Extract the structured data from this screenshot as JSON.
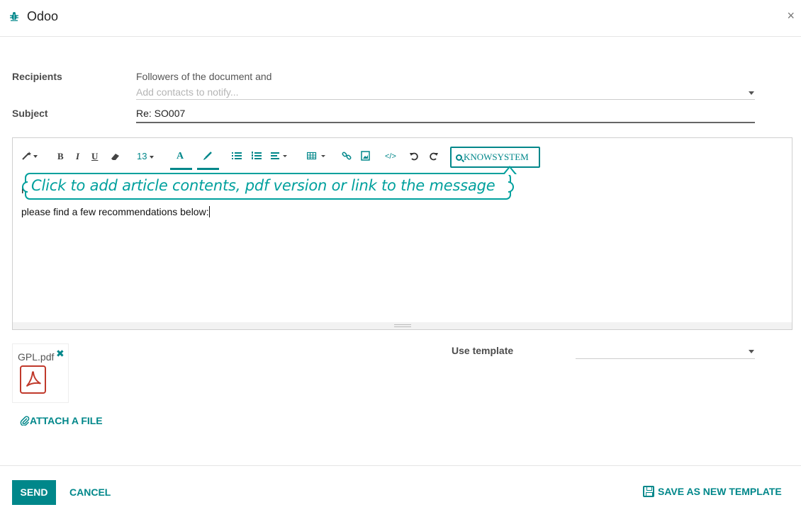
{
  "dialog": {
    "title": "Odoo",
    "close_symbol": "×"
  },
  "recipients": {
    "label": "Recipients",
    "text": "Followers of the document and",
    "placeholder": "Add contacts to notify..."
  },
  "subject": {
    "label": "Subject",
    "value": "Re: SO007"
  },
  "editor": {
    "toolbar": {
      "font_size": "13",
      "bold": "B",
      "italic": "I",
      "underline": "U",
      "text_color": "A",
      "knowsystem": "KNOWSYSTEM"
    },
    "tooltip": "Click to add article contents, pdf version or link to the message",
    "hidden_line": "H",
    "body_line": "please find a few recommendations below:"
  },
  "attachment": {
    "file_name": "GPL.pdf",
    "remove_symbol": "✖"
  },
  "attach_file_label": "ATTACH A FILE",
  "use_template": {
    "label": "Use template",
    "value": ""
  },
  "footer": {
    "send": "SEND",
    "cancel": "CANCEL",
    "save_template": "SAVE AS NEW TEMPLATE"
  },
  "colors": {
    "accent": "#00878a",
    "tooltip": "#00a09d",
    "pdf_red": "#c0392b"
  },
  "icons": [
    "bug-icon",
    "close-icon",
    "magic-wand-icon",
    "eraser-icon",
    "brush-icon",
    "list-unordered-icon",
    "list-ordered-icon",
    "align-icon",
    "table-icon",
    "link-icon",
    "image-icon",
    "code-icon",
    "undo-icon",
    "redo-icon",
    "search-icon",
    "pdf-icon",
    "paperclip-icon",
    "floppy-icon",
    "chevron-down-icon"
  ]
}
